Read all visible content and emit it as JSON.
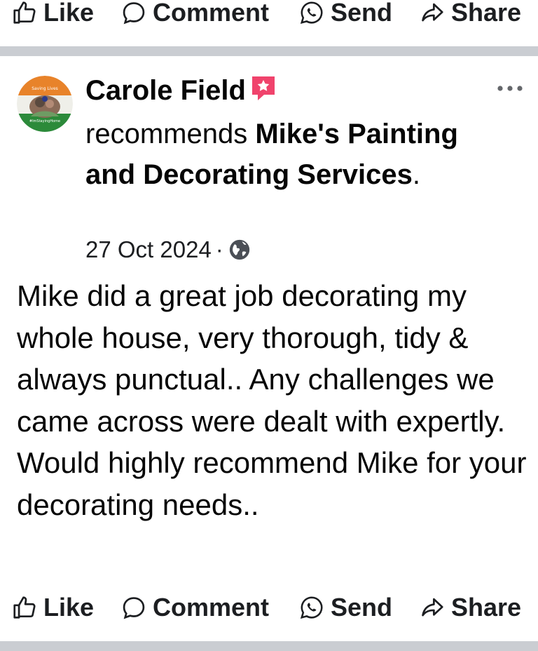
{
  "actions": {
    "like": "Like",
    "comment": "Comment",
    "send": "Send",
    "share": "Share"
  },
  "post": {
    "author": "Carole Field",
    "recommends_word": "recommends",
    "page_name": "Mike's Painting and Decorating Services",
    "page_suffix": ".",
    "date": "27 Oct 2024",
    "meta_separator": "·",
    "audience_icon": "globe-icon",
    "avatar_text_top": "Saving Lives",
    "avatar_text_bottom": "#ImStayingHome",
    "body": "Mike did a great job decorating my whole house, very thorough, tidy & always punctual.. Any challenges we came across were dealt with expertly. Would highly recommend Mike for your decorating needs.."
  },
  "colors": {
    "text": "#050505",
    "icon": "#65676b",
    "divider": "#cacdd2",
    "badge": "#f0436c"
  }
}
